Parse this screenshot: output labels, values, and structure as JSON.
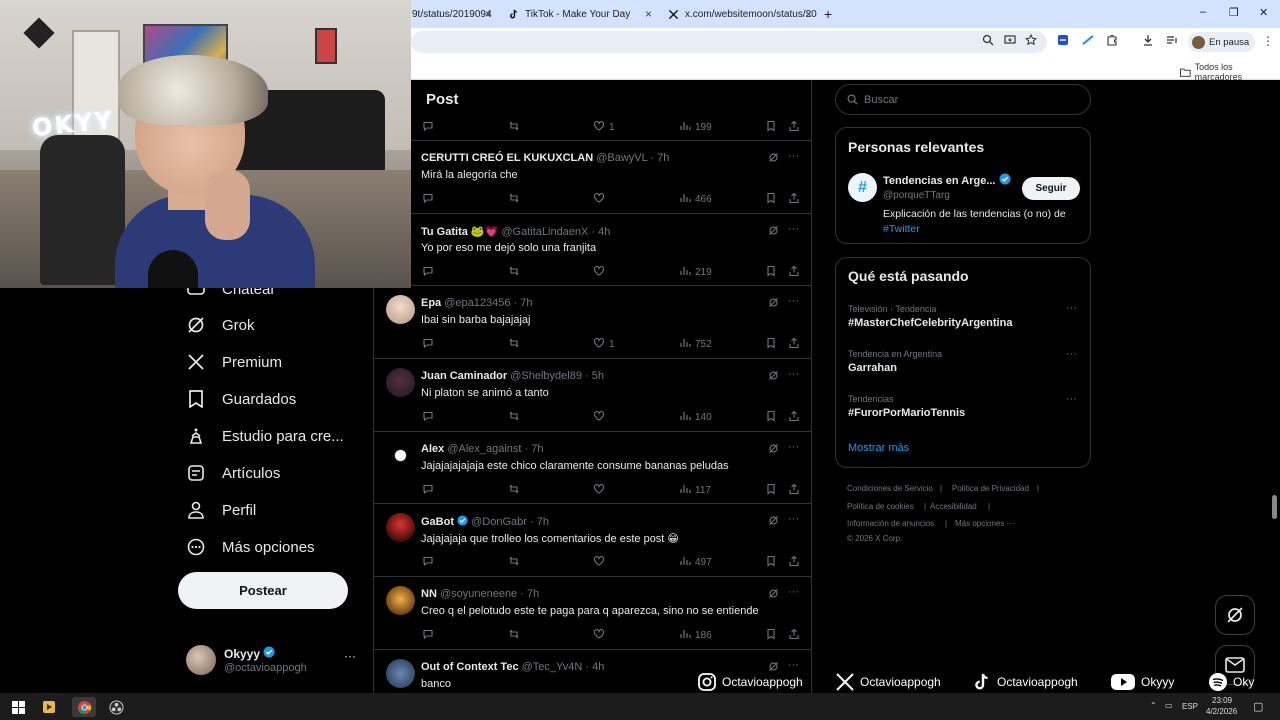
{
  "browser": {
    "tabs": [
      {
        "label": "9t/status/2019094",
        "close": "×"
      },
      {
        "label": "TikTok - Make Your Day",
        "close": "×"
      },
      {
        "label": "x.com/websitemoon/status/20",
        "close": "×"
      }
    ],
    "new_tab": "+",
    "window_controls": {
      "minimize": "–",
      "restore": "❐",
      "close": "✕"
    },
    "profile_status": "En pausa",
    "bookmarks_all": "Todos los marcadores"
  },
  "nav": {
    "items": [
      {
        "label": "Chatear",
        "icon": "chat-icon"
      },
      {
        "label": "Grok",
        "icon": "grok-icon"
      },
      {
        "label": "Premium",
        "icon": "x-logo-icon"
      },
      {
        "label": "Guardados",
        "icon": "bookmark-icon"
      },
      {
        "label": "Estudio para cre...",
        "icon": "studio-icon"
      },
      {
        "label": "Artículos",
        "icon": "articles-icon"
      },
      {
        "label": "Perfil",
        "icon": "person-icon"
      },
      {
        "label": "Más opciones",
        "icon": "more-circle-icon"
      }
    ],
    "post_button": "Postear",
    "account": {
      "name": "Okyyy",
      "handle": "@octavioappogh",
      "more": "···"
    }
  },
  "post_header": "Post",
  "replies": [
    {
      "name": "",
      "handle": "",
      "time": "",
      "text": "",
      "likes": "1",
      "views": "199"
    },
    {
      "name": "CERUTTI CREÓ EL KUKUXCLAN",
      "handle": "@BawyVL",
      "time": "· 7h",
      "text": "Mirá la alegoría che",
      "likes": "",
      "views": "466"
    },
    {
      "name": "Tu Gatita 🐸💗",
      "handle": "@GatitaLindaenX",
      "time": "· 4h",
      "text": "Yo por eso me dejó solo una franjita",
      "likes": "",
      "views": "219"
    },
    {
      "name": "Epa",
      "handle": "@epa123456",
      "time": "· 7h",
      "text": "Ibai sin barba bajajajaj",
      "likes": "1",
      "views": "752"
    },
    {
      "name": "Juan Caminador",
      "handle": "@Shelbydel89",
      "time": "· 5h",
      "text": "Ni platon se animó a tanto",
      "likes": "",
      "views": "140"
    },
    {
      "name": "Alex",
      "handle": "@Alex_against",
      "time": "· 7h",
      "text": "Jajajajajajaja este chico claramente consume bananas peludas",
      "likes": "",
      "views": "117"
    },
    {
      "name": "GaBot",
      "handle": "@DonGabr",
      "time": "· 7h",
      "text": "Jajajajaja que trolleo los comentarios de este post 😁",
      "likes": "",
      "views": "497"
    },
    {
      "name": "NN",
      "handle": "@soyuneneene",
      "time": "· 7h",
      "text": "Creo q el pelotudo este te paga para q aparezca, sino no se entiende",
      "likes": "",
      "views": "186"
    },
    {
      "name": "Out of Context Tec",
      "handle": "@Tec_Yv4N",
      "time": "· 4h",
      "text": "banco",
      "likes": "",
      "views": ""
    }
  ],
  "sidebar": {
    "search_placeholder": "Buscar",
    "relevant": {
      "title": "Personas relevantes",
      "name": "Tendencias en Arge...",
      "handle": "@porqueTTarg",
      "follow": "Seguir",
      "bio": "Explicación de las tendencias (o no) de",
      "bio_link": "#Twitter"
    },
    "trending": {
      "title": "Qué está pasando",
      "items": [
        {
          "meta": "Televisión · Tendencia",
          "name": "#MasterChefCelebrityArgentina"
        },
        {
          "meta": "Tendencia en Argentina",
          "name": "Garrahan"
        },
        {
          "meta": "Tendencias",
          "name": "#FurorPorMarioTennis"
        }
      ],
      "show_more": "Mostrar más"
    },
    "footer": {
      "terms": "Condiciones de Servicio",
      "privacy": "Política de Privacidad",
      "cookies": "Política de cookies",
      "accessibility": "Accesibilidad",
      "ads": "Información de anuncios",
      "more": "Más opciones ···",
      "copyright": "© 2026 X Corp."
    }
  },
  "overlay": {
    "instagram": "Octavioappogh",
    "x": "Octavioappogh",
    "tiktok": "Octavioappogh",
    "youtube": "Okyyy",
    "spotify": "Oky"
  },
  "webcam_sign": "OKYY",
  "taskbar": {
    "lang": "ESP",
    "time": "23:09",
    "date": "4/2/2026"
  },
  "colors": {
    "accent": "#1d9bf0",
    "background": "#000000",
    "border": "#2f3336",
    "muted": "#71767b"
  }
}
